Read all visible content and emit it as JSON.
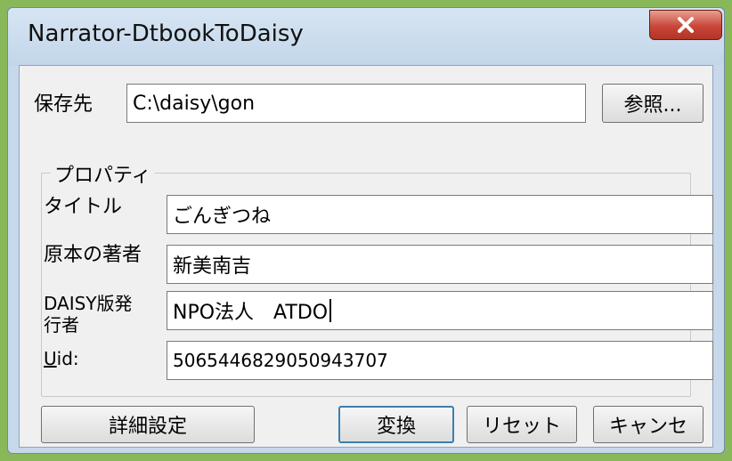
{
  "window": {
    "title": "Narrator-DtbookToDaisy"
  },
  "save": {
    "label": "保存先",
    "path": "C:\\daisy\\gon",
    "browse_label": "参照..."
  },
  "properties": {
    "group_title": "プロパティ",
    "title_label": "タイトル",
    "title_value": "ごんぎつね",
    "author_label": "原本の著者",
    "author_value": "新美南吉",
    "publisher_label": "DAISY版発行者",
    "publisher_value": "NPO法人　ATDO",
    "uid_label_mnemonic": "U",
    "uid_label_rest": "id:",
    "uid_value": "5065446829050943707"
  },
  "buttons": {
    "details": "詳細設定",
    "convert": "変換",
    "reset": "リセット",
    "cancel": "キャンセ"
  }
}
